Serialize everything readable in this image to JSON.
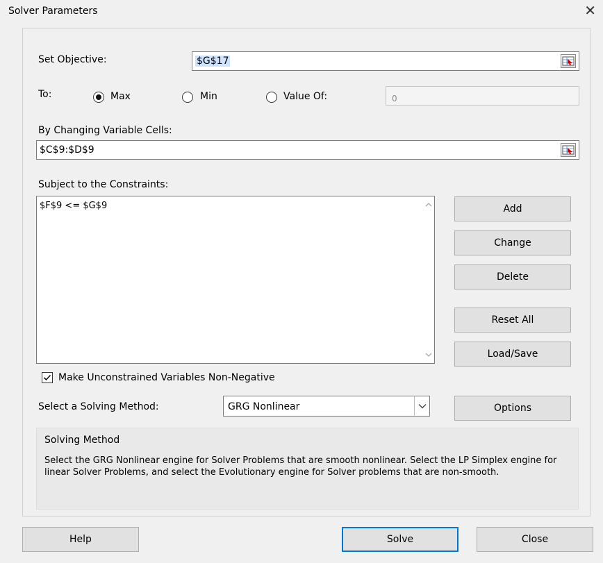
{
  "window": {
    "title": "Solver Parameters"
  },
  "objective": {
    "label": "Set Objective:",
    "value": "$G$17"
  },
  "to": {
    "label": "To:",
    "options": [
      {
        "label": "Max",
        "selected": true
      },
      {
        "label": "Min",
        "selected": false
      },
      {
        "label": "Value Of:",
        "selected": false
      }
    ],
    "value_of": "0"
  },
  "variables": {
    "label": "By Changing Variable Cells:",
    "value": "$C$9:$D$9"
  },
  "constraints": {
    "label": "Subject to the Constraints:",
    "items": [
      "$F$9 <= $G$9"
    ]
  },
  "side_buttons": [
    "Add",
    "Change",
    "Delete",
    "Reset All",
    "Load/Save"
  ],
  "nonnegative": {
    "label": "Make Unconstrained Variables Non-Negative",
    "checked": true
  },
  "method": {
    "label": "Select a Solving Method:",
    "selected": "GRG Nonlinear",
    "options_label": "Options"
  },
  "solving_method": {
    "title": "Solving Method",
    "description": "Select the GRG Nonlinear engine for Solver Problems that are smooth nonlinear. Select the LP Simplex engine for linear Solver Problems, and select the Evolutionary engine for Solver problems that are non-smooth."
  },
  "footer": {
    "help": "Help",
    "solve": "Solve",
    "close": "Close"
  },
  "colors": {
    "accent": "#0078d7",
    "dialog_bg": "#f0f0f0"
  }
}
